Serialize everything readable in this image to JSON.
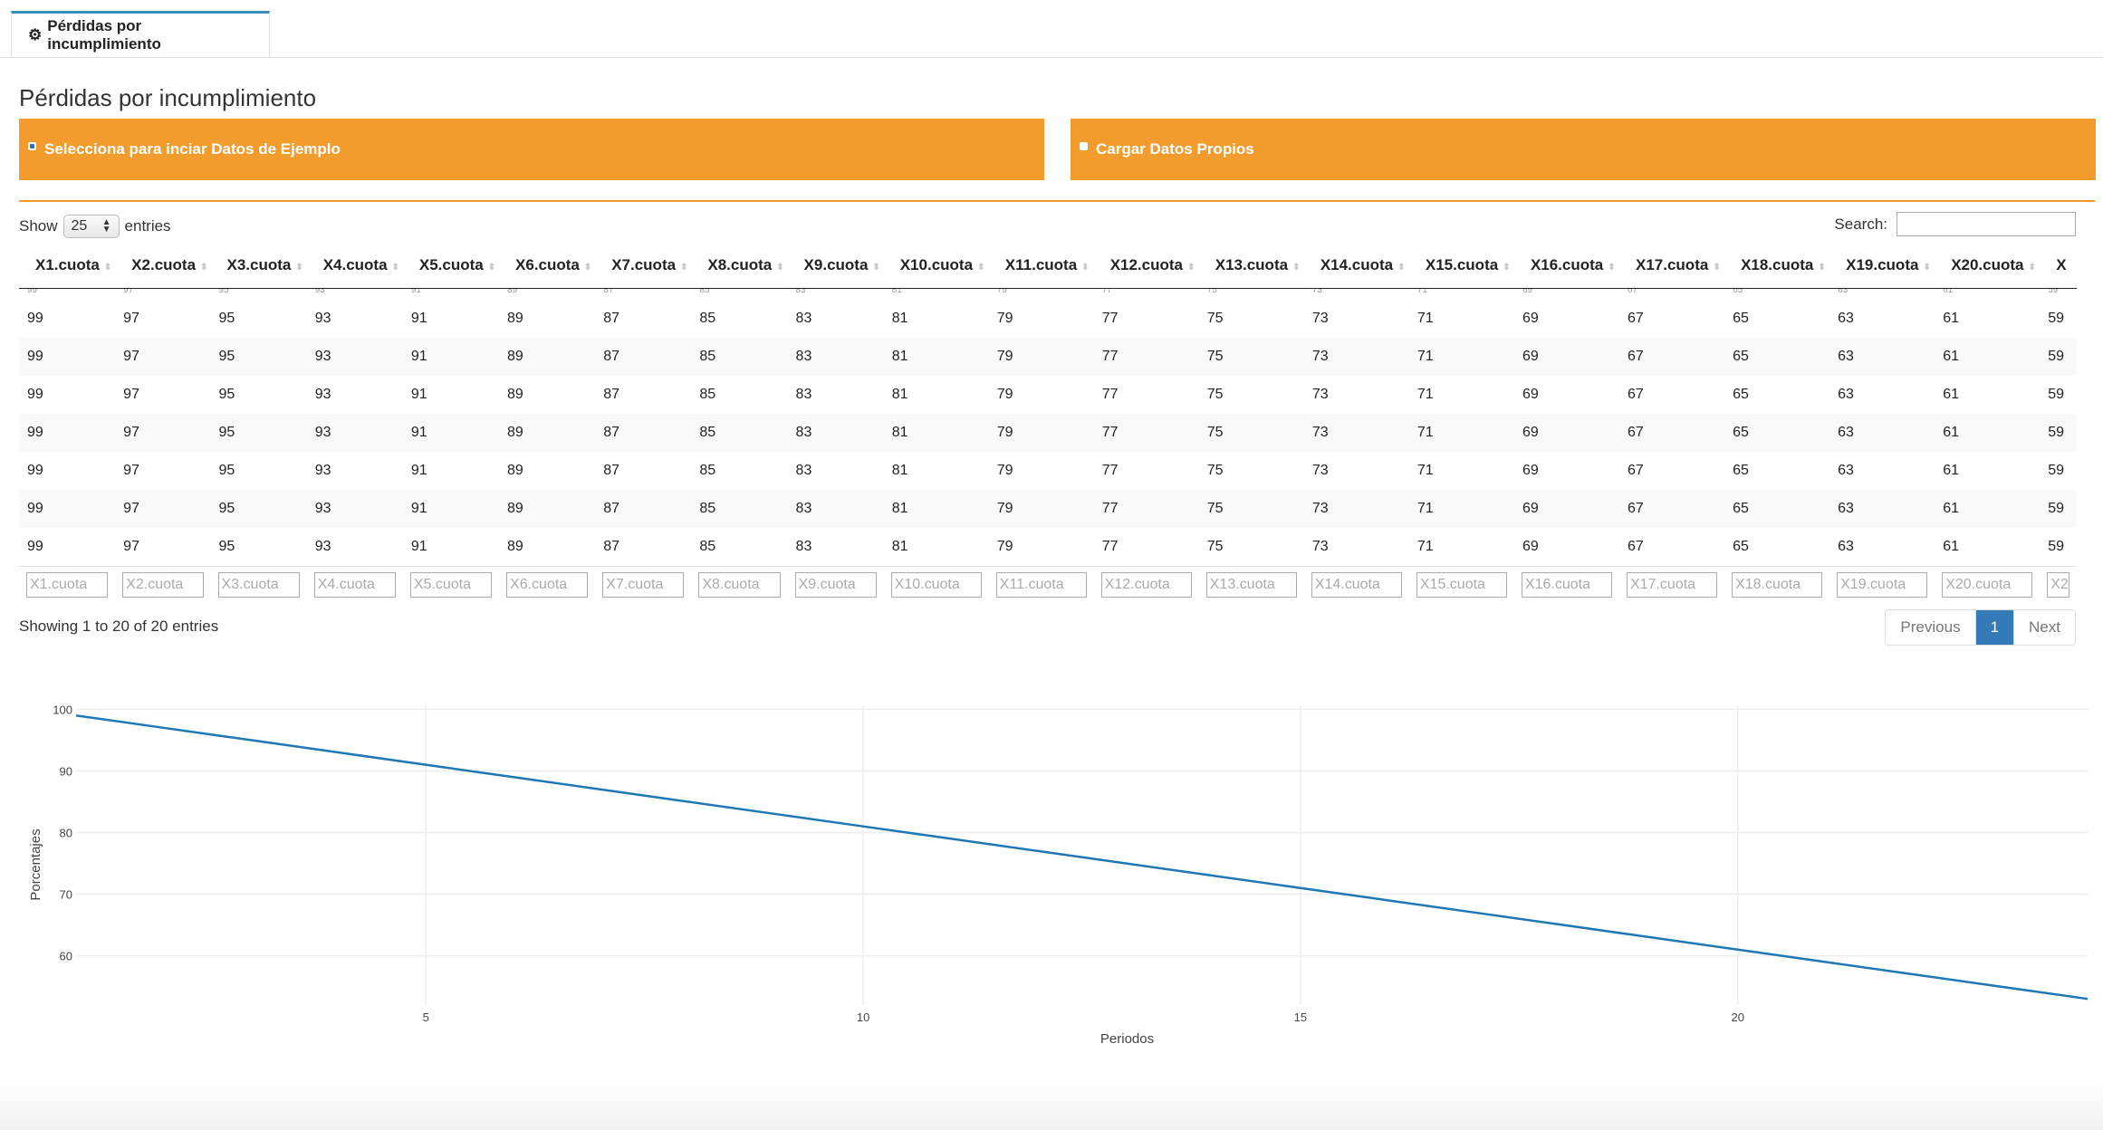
{
  "tab": {
    "icon": "gear-icon",
    "label": "Pérdidas por incumplimiento"
  },
  "page_title": "Pérdidas por incumplimiento",
  "options": [
    {
      "label": "Selecciona para inciar Datos de Ejemplo",
      "checked": true
    },
    {
      "label": "Cargar Datos Propios",
      "checked": false
    }
  ],
  "datatable": {
    "show_label": "Show",
    "length_value": "25",
    "entries_label": "entries",
    "search_label": "Search:",
    "search_value": "",
    "columns": [
      "X1.cuota",
      "X2.cuota",
      "X3.cuota",
      "X4.cuota",
      "X5.cuota",
      "X6.cuota",
      "X7.cuota",
      "X8.cuota",
      "X9.cuota",
      "X10.cuota",
      "X11.cuota",
      "X12.cuota",
      "X13.cuota",
      "X14.cuota",
      "X15.cuota",
      "X16.cuota",
      "X17.cuota",
      "X18.cuota",
      "X19.cuota",
      "X20.cuota",
      "X"
    ],
    "row_values": [
      "99",
      "97",
      "95",
      "93",
      "91",
      "89",
      "87",
      "85",
      "83",
      "81",
      "79",
      "77",
      "75",
      "73",
      "71",
      "69",
      "67",
      "65",
      "63",
      "61",
      "59"
    ],
    "visible_rows": 7,
    "filter_placeholders": [
      "X1.cuota",
      "X2.cuota",
      "X3.cuota",
      "X4.cuota",
      "X5.cuota",
      "X6.cuota",
      "X7.cuota",
      "X8.cuota",
      "X9.cuota",
      "X10.cuota",
      "X11.cuota",
      "X12.cuota",
      "X13.cuota",
      "X14.cuota",
      "X15.cuota",
      "X16.cuota",
      "X17.cuota",
      "X18.cuota",
      "X19.cuota",
      "X20.cuota",
      "X2"
    ],
    "info": "Showing 1 to 20 of 20 entries",
    "pagination": {
      "previous": "Previous",
      "current": "1",
      "next": "Next"
    }
  },
  "chart_data": {
    "type": "line",
    "xlabel": "Periodos",
    "ylabel": "Porcentajes",
    "x": [
      1,
      2,
      3,
      4,
      5,
      6,
      7,
      8,
      9,
      10,
      11,
      12,
      13,
      14,
      15,
      16,
      17,
      18,
      19,
      20,
      21,
      22,
      23,
      24
    ],
    "series": [
      {
        "values": [
          99,
          97,
          95,
          93,
          91,
          89,
          87,
          85,
          83,
          81,
          79,
          77,
          75,
          73,
          71,
          69,
          67,
          65,
          63,
          61,
          59,
          57,
          55,
          53
        ]
      }
    ],
    "xticks": [
      5,
      10,
      15,
      20
    ],
    "yticks": [
      60,
      70,
      80,
      90,
      100
    ],
    "xlim": [
      1,
      24
    ],
    "ylim": [
      52,
      100.5
    ],
    "grid": true,
    "line_color": "#1f77b4"
  }
}
